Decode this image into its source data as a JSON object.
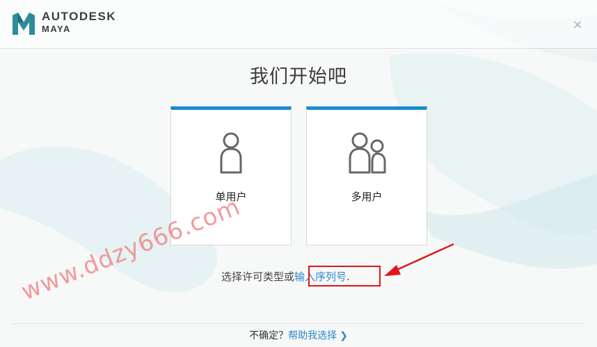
{
  "header": {
    "brand": "AUTODESK",
    "product": "MAYA",
    "close_glyph": "×",
    "logo_icon": "maya-logo-icon",
    "close_icon": "close-icon"
  },
  "title": "我们开始吧",
  "cards": [
    {
      "label": "单用户",
      "icon": "single-user-icon"
    },
    {
      "label": "多用户",
      "icon": "multi-user-icon"
    }
  ],
  "license": {
    "prompt": "选择许可类型或",
    "serial_link": "输入序列号",
    "period": "."
  },
  "watermark": "www.ddzy666.com",
  "footer": {
    "question": "不确定？",
    "help_link": "帮助我选择",
    "chevron": "❯"
  },
  "colors": {
    "accent": "#1a8ccd",
    "link": "#2e88c9",
    "annotation_red": "#e0161b",
    "watermark": "#f08a8a"
  }
}
